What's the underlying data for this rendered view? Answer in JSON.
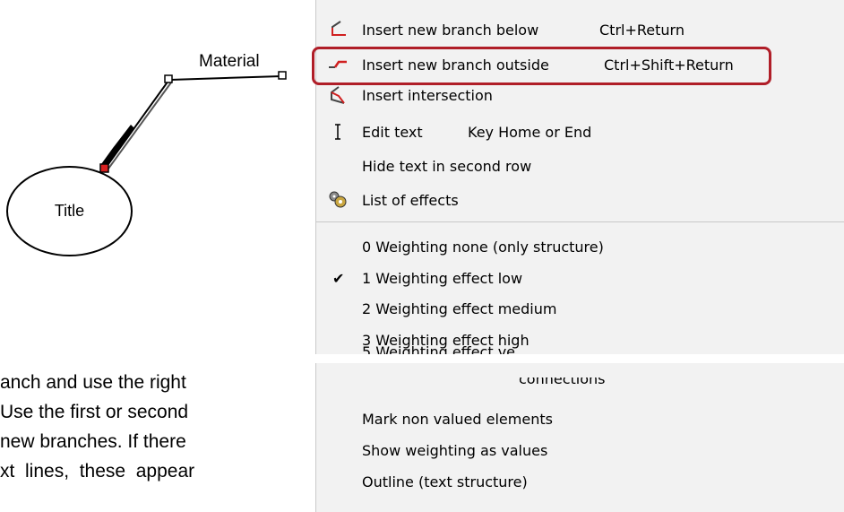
{
  "diagram": {
    "title": "Title",
    "branch": "Material"
  },
  "paragraph": {
    "lines": [
      "anch and use the right",
      "Use the first or second",
      "new branches. If there",
      "xt  lines,  these  appear"
    ]
  },
  "menu": {
    "items": [
      {
        "label": "Insert new branch below",
        "shortcut": "Ctrl+Return",
        "icon": "branch-below-icon"
      },
      {
        "label": "Insert new branch outside",
        "shortcut": "Ctrl+Shift+Return",
        "icon": "branch-outside-icon"
      },
      {
        "label": "Insert intersection",
        "shortcut": "",
        "icon": "intersection-icon"
      },
      {
        "label": "Edit text",
        "shortcut": "Key Home or End",
        "icon": "text-cursor-icon"
      },
      {
        "label": "Hide text in second row",
        "shortcut": ""
      },
      {
        "label": "List of effects",
        "shortcut": "",
        "icon": "effects-gear-icon"
      }
    ],
    "weighting": [
      {
        "label": "0 Weighting none (only structure)",
        "checked": false
      },
      {
        "label": "1 Weighting effect low",
        "checked": true
      },
      {
        "label": "2 Weighting effect medium",
        "checked": false
      },
      {
        "label": "3 Weighting effect high",
        "checked": false
      },
      {
        "label": "5 Weighting effect ve",
        "checked": false
      }
    ],
    "lower": [
      {
        "label": "connections"
      },
      {
        "label": "Mark non valued elements"
      },
      {
        "label": "Show weighting as values"
      },
      {
        "label": "Outline (text structure)"
      }
    ]
  },
  "colors": {
    "highlight": "#b01e28",
    "menu_bg": "#f2f2f2"
  }
}
